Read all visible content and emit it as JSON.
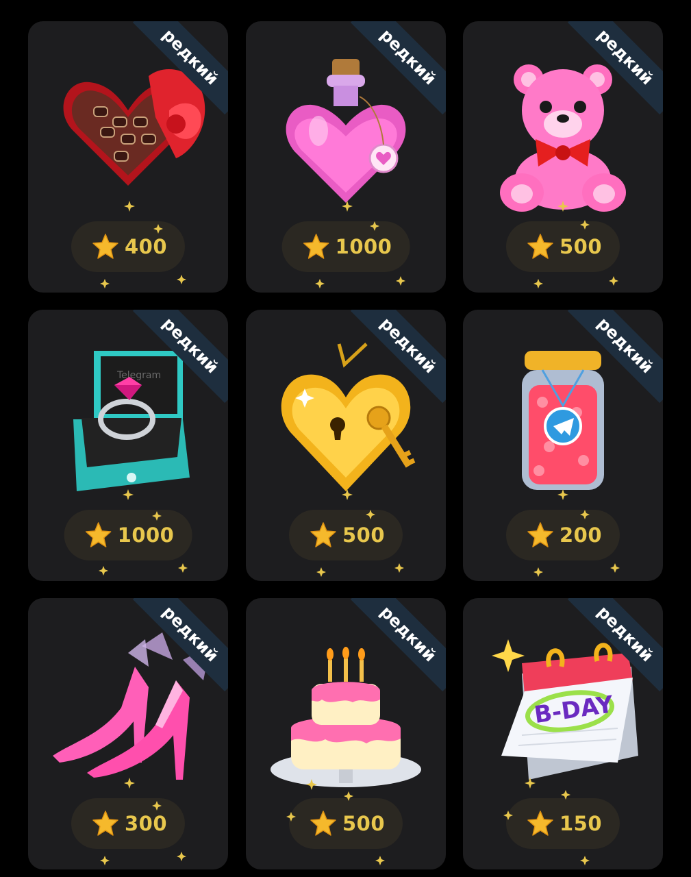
{
  "rarity_label": "редкий",
  "colors": {
    "page_background": "#000000",
    "card_background": "#1d1d1f",
    "ribbon_background": "#1e2e3e",
    "price_pill_background": "#2b2822",
    "price_text": "#e8c74d",
    "star": "#f5b92c"
  },
  "gifts": [
    {
      "name": "heart-chocolate-box",
      "icon": "heart-candy-box-icon",
      "rarity": "редкий",
      "price": "400"
    },
    {
      "name": "love-potion",
      "icon": "love-potion-bottle-icon",
      "rarity": "редкий",
      "price": "1000"
    },
    {
      "name": "pink-teddy-bear",
      "icon": "teddy-bear-icon",
      "rarity": "редкий",
      "price": "500"
    },
    {
      "name": "ring-box",
      "icon": "ring-box-icon",
      "rarity": "редкий",
      "price": "1000",
      "box_text": "Telegram"
    },
    {
      "name": "golden-heart-locket",
      "icon": "heart-locket-key-icon",
      "rarity": "редкий",
      "price": "500"
    },
    {
      "name": "jar-of-hearts",
      "icon": "jar-of-hearts-icon",
      "rarity": "редкий",
      "price": "200"
    },
    {
      "name": "pink-heels",
      "icon": "high-heels-icon",
      "rarity": "редкий",
      "price": "300"
    },
    {
      "name": "birthday-cake",
      "icon": "birthday-cake-icon",
      "rarity": "редкий",
      "price": "500"
    },
    {
      "name": "bday-calendar",
      "icon": "bday-calendar-icon",
      "rarity": "редкий",
      "price": "150",
      "calendar_text": "B-DAY"
    }
  ]
}
